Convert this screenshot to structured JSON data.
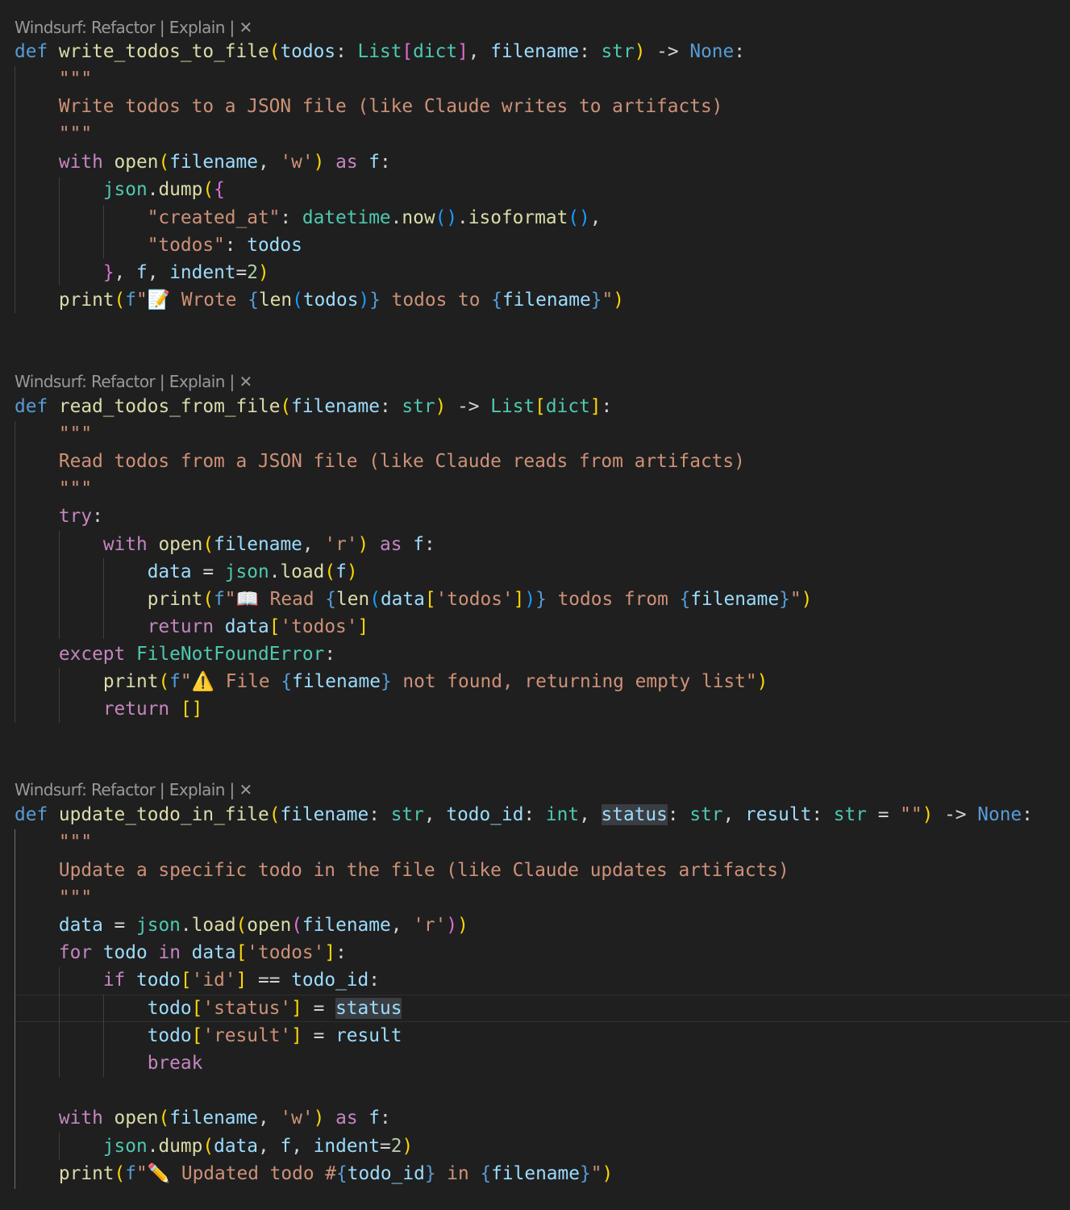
{
  "codelens": {
    "prefix": "Windsurf: ",
    "refactor": "Refactor",
    "sep": " | ",
    "explain": "Explain",
    "close": "✕"
  },
  "functions": [
    {
      "name": "write_todos_to_file",
      "docstring": "Write todos to a JSON file (like Claude writes to artifacts)",
      "emoji": "📝",
      "message": " Wrote "
    },
    {
      "name": "read_todos_from_file",
      "docstring": "Read todos from a JSON file (like Claude reads from artifacts)",
      "emoji": "📖",
      "message": " Read ",
      "warn_emoji": "⚠️",
      "warn_message": " File "
    },
    {
      "name": "update_todo_in_file",
      "docstring": "Update a specific todo in the file (like Claude updates artifacts)",
      "emoji": "✏️",
      "message": " Updated todo #"
    }
  ]
}
